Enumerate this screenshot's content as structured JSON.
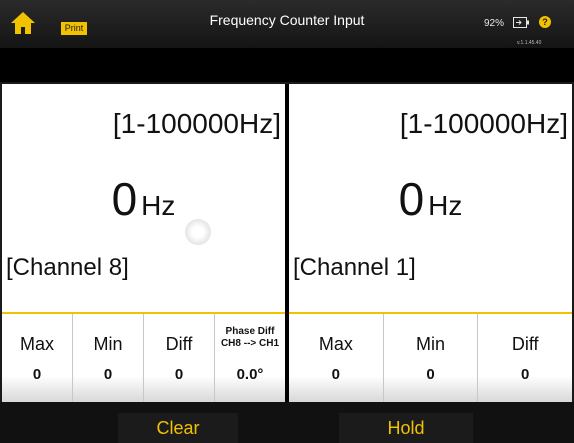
{
  "header": {
    "title": "Frequency Counter Input",
    "print_label": "Print",
    "battery_percent": "92%",
    "version": "v.1.1.45.40",
    "help_label": "?",
    "icons": {
      "home": "home-icon",
      "battery": "battery-icon",
      "help": "help-icon"
    }
  },
  "left_panel": {
    "range": "[1-100000Hz]",
    "value": "0",
    "unit": "Hz",
    "channel": "[Channel 8]",
    "stats": {
      "max_label": "Max",
      "max_value": "0",
      "min_label": "Min",
      "min_value": "0",
      "diff_label": "Diff",
      "diff_value": "0",
      "phase_label_line1": "Phase Diff",
      "phase_label_line2": "CH8 --> CH1",
      "phase_value": "0.0°"
    }
  },
  "right_panel": {
    "range": "[1-100000Hz]",
    "value": "0",
    "unit": "Hz",
    "channel": "[Channel 1]",
    "stats": {
      "max_label": "Max",
      "max_value": "0",
      "min_label": "Min",
      "min_value": "0",
      "diff_label": "Diff",
      "diff_value": "0"
    }
  },
  "buttons": {
    "clear_label": "Clear",
    "hold_label": "Hold"
  },
  "colors": {
    "accent": "#f2c200",
    "header_bg": "#1f1f1f",
    "panel_bg": "#ffffff"
  }
}
